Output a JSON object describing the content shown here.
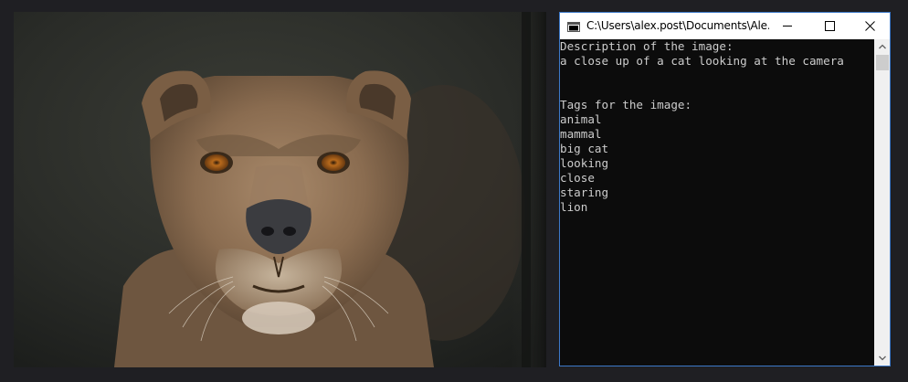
{
  "window": {
    "title": "C:\\Users\\alex.post\\Documents\\Ale..."
  },
  "console": {
    "lines": [
      "Description of the image:",
      "a close up of a cat looking at the camera",
      "",
      "",
      "Tags for the image:",
      "animal",
      "mammal",
      "big cat",
      "looking",
      "close",
      "staring",
      "lion"
    ]
  },
  "icons": {
    "window": "console-app-icon",
    "minimize": "minimize-icon",
    "maximize": "maximize-icon",
    "close": "close-icon",
    "scroll_up": "chevron-up-icon",
    "scroll_down": "chevron-down-icon"
  },
  "colors": {
    "console_bg": "#0c0c0c",
    "console_text": "#cccccc",
    "window_border": "#3c78c8",
    "desktop_bg": "#1f1f23"
  }
}
